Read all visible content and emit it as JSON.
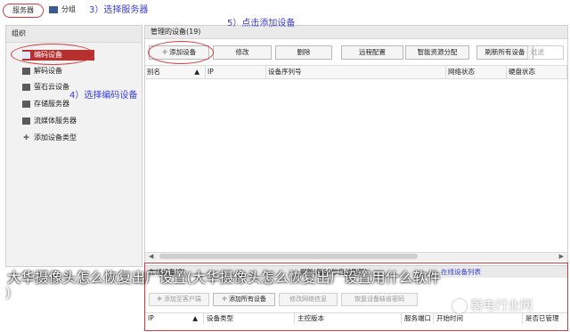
{
  "top_tabs": {
    "server": "服务器",
    "group": "分组"
  },
  "annotations": {
    "step3": "3）选择服务器",
    "step4": "4）选择编码设备",
    "step5": "5）点击添加设备"
  },
  "sidebar": {
    "header": "组织",
    "items": [
      {
        "label": "编码设备",
        "icon": "encoder-device-icon",
        "selected": true
      },
      {
        "label": "解码设备",
        "icon": "decoder-device-icon"
      },
      {
        "label": "萤石云设备",
        "icon": "cloud-device-icon"
      },
      {
        "label": "存储服务器",
        "icon": "storage-server-icon"
      },
      {
        "label": "流媒体服务器",
        "icon": "media-server-icon"
      },
      {
        "label": "添加设备类型",
        "icon": "add-type-icon"
      }
    ]
  },
  "main": {
    "header": "管理的设备(19)",
    "toolbar": {
      "add": "添加设备",
      "modify": "修改",
      "delete": "删除",
      "remote_config": "远程配置",
      "smart_alloc": "智能资源分配",
      "refresh_all": "刷新所有设备",
      "filter_placeholder": "过滤"
    },
    "columns": [
      "别名",
      "IP",
      "设备序列号",
      "网络状态",
      "硬盘状态"
    ]
  },
  "bottom": {
    "header_left": "在线设备(0)",
    "header_mid": "刷新(每60秒自动刷新)",
    "header_right": "在线设备列表",
    "buttons": {
      "add_client": "添加至客户端",
      "add_all": "添加所有设备",
      "modify_net": "修改网络信息",
      "restore_pwd": "恢复设备缺省密码"
    },
    "columns": [
      "IP",
      "设备类型",
      "主控版本",
      "服务端口",
      "开始时间",
      "是否已管理"
    ]
  },
  "overlay": {
    "watermark_line1": "大华摄像头怎么恢复出厂设置(大华摄像头怎么恢复出厂设置用什么软件",
    "watermark_line2": ")",
    "site_logo": "弱电行业网"
  },
  "colors": {
    "accent_red": "#d73a3a",
    "annotation_blue": "#3b3bdc",
    "selected_bg": "#b73030"
  }
}
